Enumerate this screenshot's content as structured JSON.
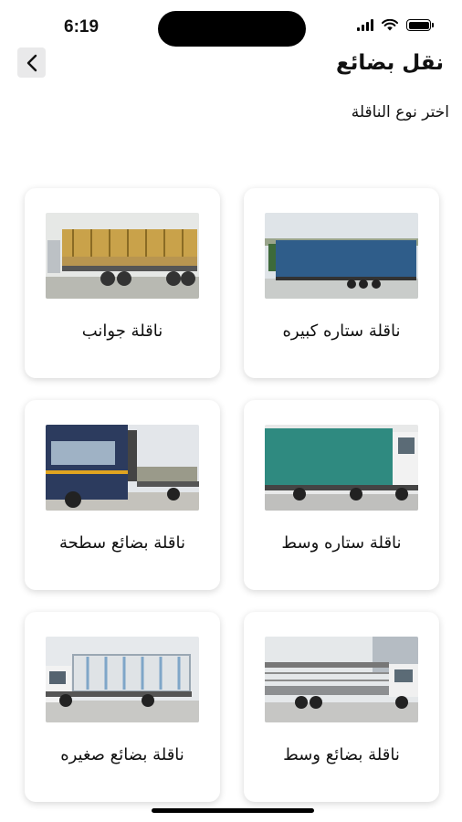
{
  "status": {
    "time": "6:19"
  },
  "header": {
    "title": "نقل بضائع",
    "back_icon": "chevron-left-icon"
  },
  "prompt": "اختر نوع الناقلة",
  "trucks": [
    {
      "label": "ناقلة ستاره كبيره",
      "image": "blue-curtain-semi-truck-photo"
    },
    {
      "label": "ناقلة جوانب",
      "image": "side-rail-semi-trailer-photo"
    },
    {
      "label": "ناقلة ستاره وسط",
      "image": "green-curtain-truck-photo"
    },
    {
      "label": "ناقلة بضائع سطحة",
      "image": "flatbed-truck-photo"
    },
    {
      "label": "ناقلة بضائع وسط",
      "image": "medium-cargo-truck-photo"
    },
    {
      "label": "ناقلة بضائع صغيره",
      "image": "small-cargo-truck-photo"
    }
  ]
}
